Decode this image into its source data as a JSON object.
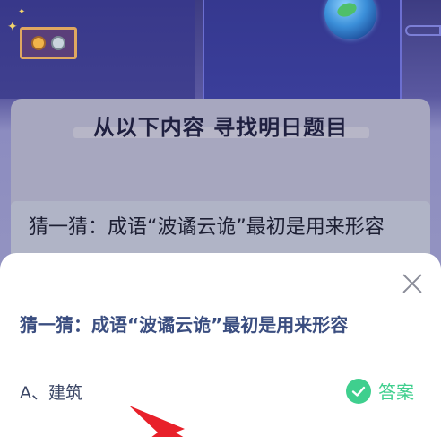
{
  "background": {
    "card_title": "从以下内容 寻找明日题目",
    "card_question": "猜一猜：成语“波谲云诡”最初是用来形容"
  },
  "sheet": {
    "question": "猜一猜：成语“波谲云诡”最初是用来形容",
    "option_a": "A、建筑",
    "answer_label": "答案"
  },
  "colors": {
    "accent_green": "#3fcf8e",
    "question_blue": "#3b4e80",
    "arrow_red": "#e8202a"
  },
  "icons": [
    "close-icon",
    "check-icon",
    "planet-icon",
    "medal-icon",
    "sparkle-icon",
    "pointer-arrow-icon"
  ]
}
